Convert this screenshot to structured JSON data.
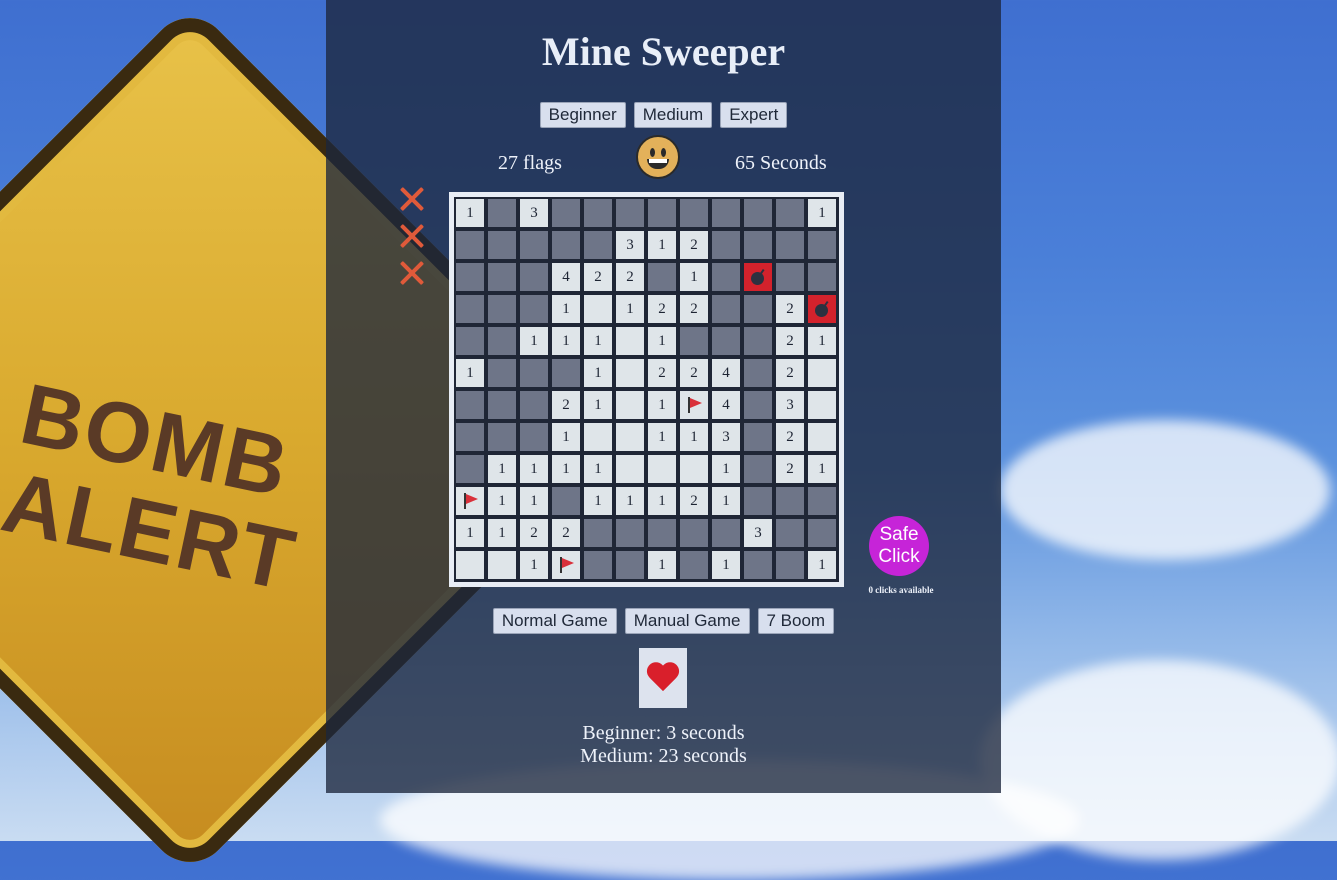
{
  "title": "Mine Sweeper",
  "levels": [
    "Beginner",
    "Medium",
    "Expert"
  ],
  "status": {
    "flags": "27 flags",
    "seconds": "65 Seconds",
    "face": "grinning-face"
  },
  "lives_lost": 3,
  "board": {
    "rows": [
      [
        "1",
        "h",
        "3",
        "h",
        "h",
        "h",
        "h",
        "h",
        "h",
        "h",
        "h",
        "1"
      ],
      [
        "h",
        "h",
        "h",
        "h",
        "h",
        "3",
        "1",
        "2",
        "h",
        "h",
        "h",
        "h"
      ],
      [
        "h",
        "h",
        "h",
        "4",
        "2",
        "2",
        "h",
        "1",
        "h",
        "M",
        "h",
        "h"
      ],
      [
        "h",
        "h",
        "h",
        "1",
        "r",
        "1",
        "2",
        "2",
        "h",
        "h",
        "2",
        "M"
      ],
      [
        "h",
        "h",
        "1",
        "1",
        "1",
        "r",
        "1",
        "h",
        "h",
        "h",
        "2",
        "1"
      ],
      [
        "1",
        "h",
        "h",
        "h",
        "1",
        "r",
        "2",
        "2",
        "4",
        "h",
        "2",
        "r"
      ],
      [
        "h",
        "h",
        "h",
        "2",
        "1",
        "r",
        "1",
        "F",
        "4",
        "h",
        "3",
        "r"
      ],
      [
        "h",
        "h",
        "h",
        "1",
        "r",
        "r",
        "1",
        "1",
        "3",
        "h",
        "2",
        "r"
      ],
      [
        "h",
        "1",
        "1",
        "1",
        "1",
        "r",
        "r",
        "r",
        "1",
        "h",
        "2",
        "1"
      ],
      [
        "F",
        "1",
        "1",
        "h",
        "1",
        "1",
        "1",
        "2",
        "1",
        "h",
        "h",
        "h"
      ],
      [
        "1",
        "1",
        "2",
        "2",
        "h",
        "h",
        "h",
        "h",
        "h",
        "3",
        "h",
        "h"
      ],
      [
        "r",
        "r",
        "1",
        "F",
        "h",
        "h",
        "1",
        "h",
        "1",
        "h",
        "h",
        "1"
      ]
    ]
  },
  "safe_click": {
    "label_line1": "Safe",
    "label_line2": "Click",
    "note": "0 clicks available"
  },
  "modes": [
    "Normal Game",
    "Manual Game",
    "7 Boom"
  ],
  "hint_icon": "heart-icon",
  "best_times": [
    "Beginner: 3 seconds",
    "Medium: 23 seconds"
  ],
  "colors": {
    "mine_cell": "#d3222c",
    "hidden_cell": "#6e7588",
    "revealed_cell": "#dfe5e9",
    "safe_button": "#c624d8"
  }
}
